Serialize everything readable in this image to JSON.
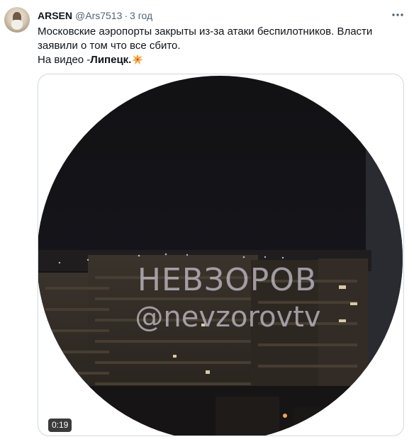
{
  "tweet": {
    "author_name": "ARSEN",
    "handle": "@Ars7513",
    "separator": "·",
    "time": "3 год",
    "text_line1": "Московские аэропорты закрыты из-за атаки беспилотников. Власти",
    "text_line2": "заявили о том что все сбито.",
    "text_line3_prefix": "На видео -",
    "text_line3_bold": "Липецк.",
    "emoji": "collision-emoji",
    "more_icon": "more-icon"
  },
  "media": {
    "watermark_title": "НЕВЗОРОВ",
    "watermark_handle": "@nevzorovtv",
    "duration": "0:19",
    "type": "video"
  },
  "colors": {
    "text": "#0f1419",
    "secondary": "#536471",
    "border": "#cfd9de",
    "video_sky": "#141315",
    "buildings": "#2e2822"
  }
}
